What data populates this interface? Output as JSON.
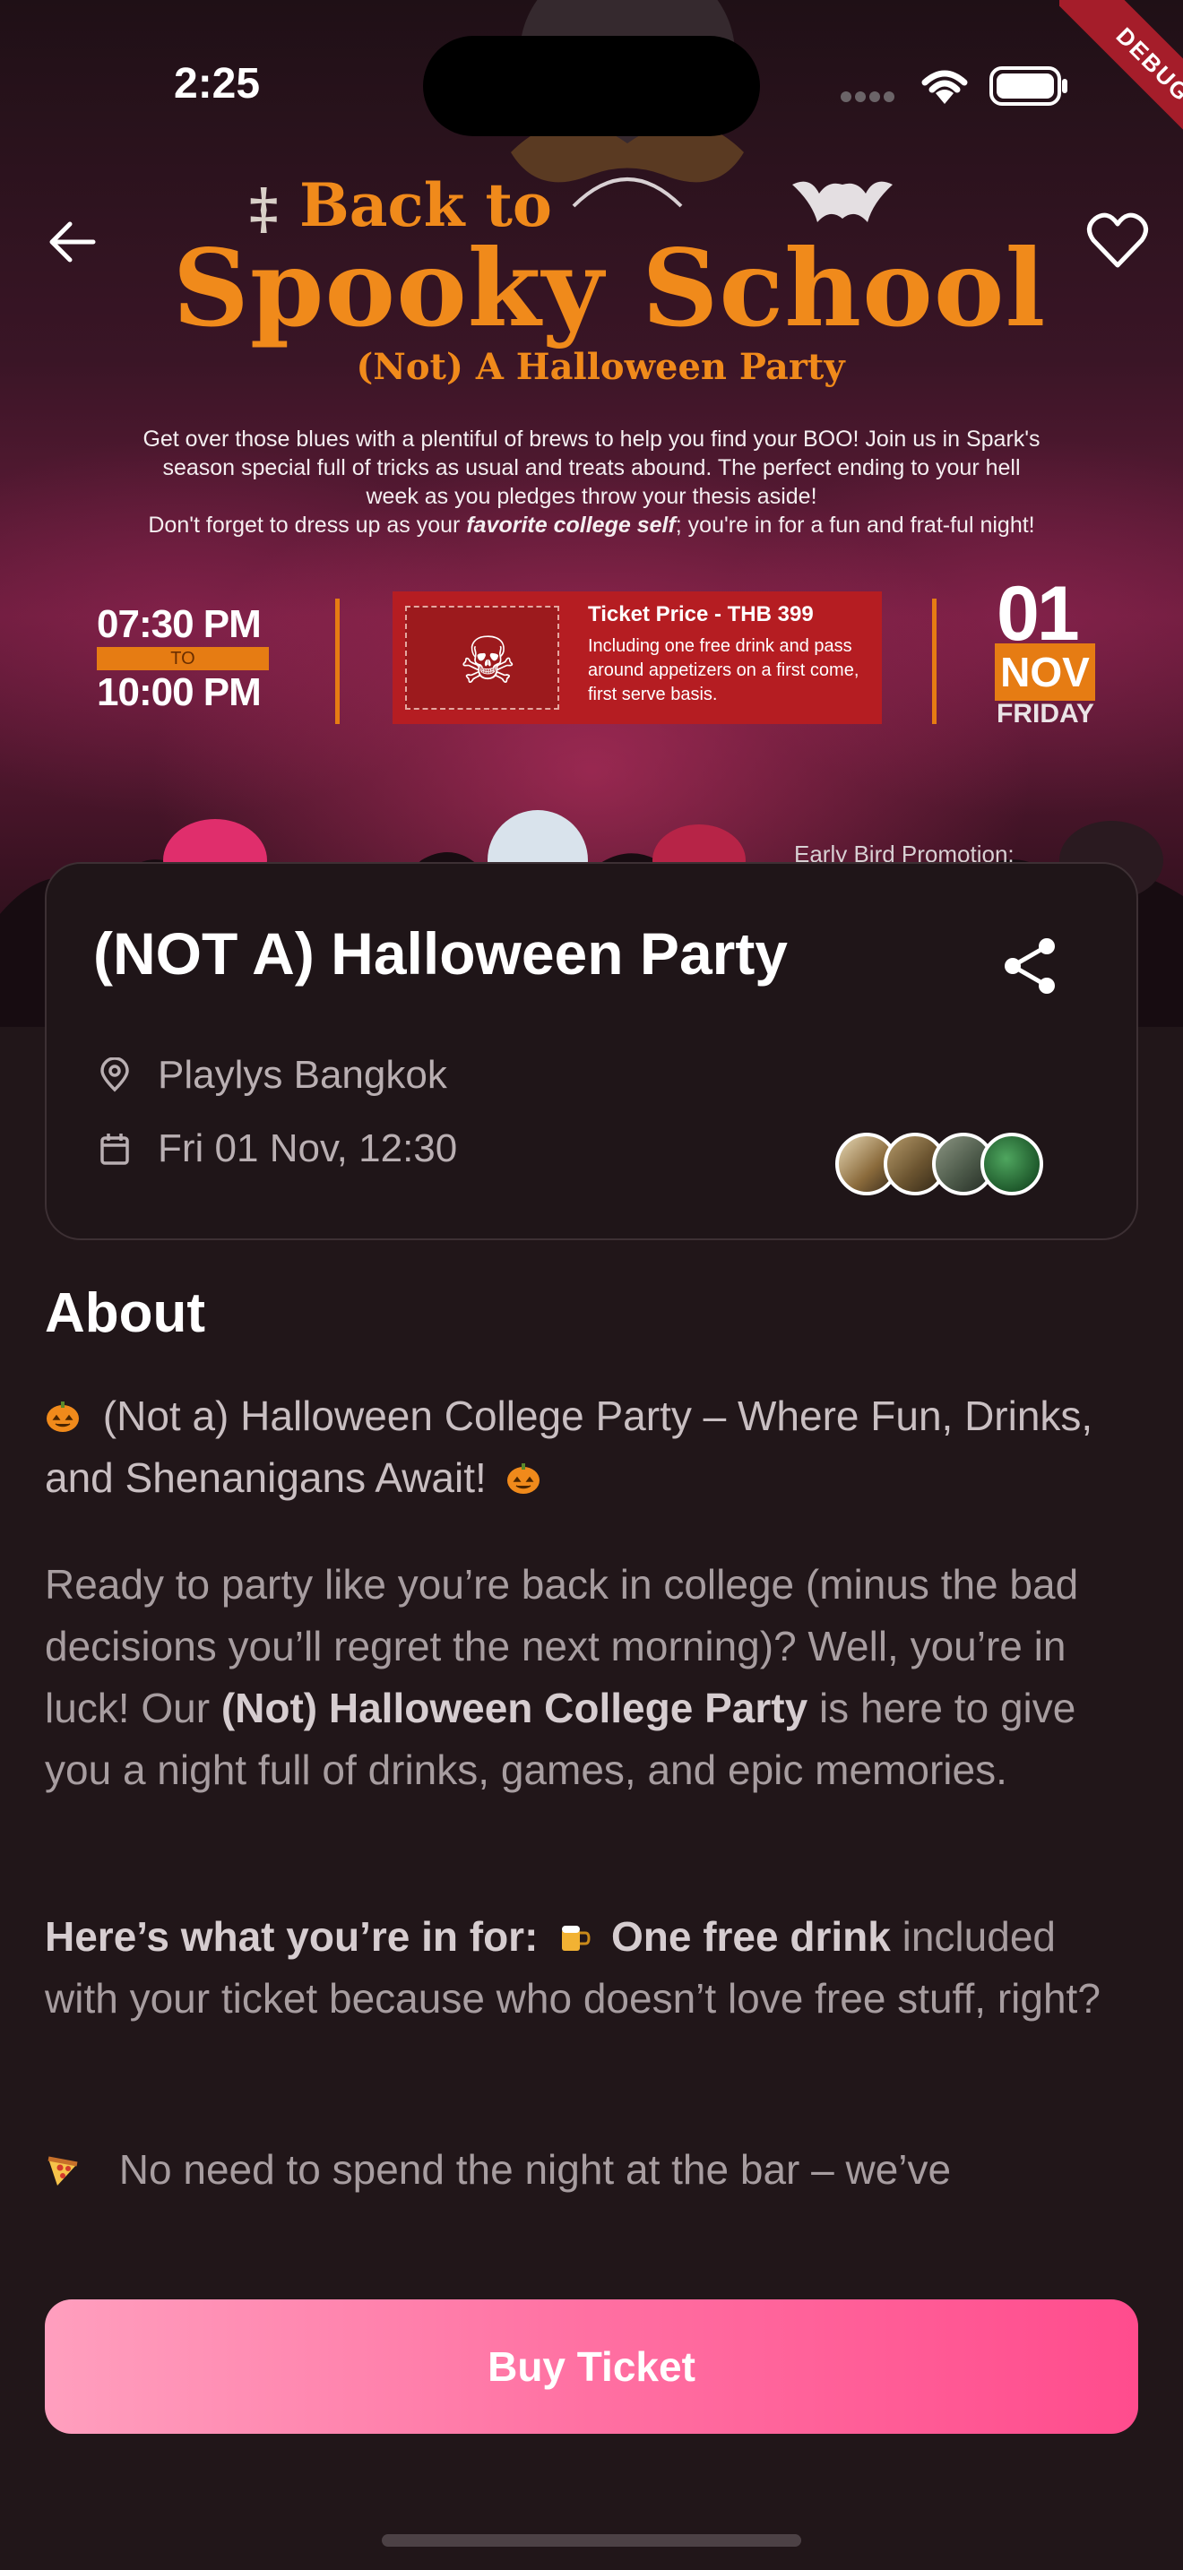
{
  "status_bar": {
    "time": "2:25",
    "debug_label": "DEBUG"
  },
  "poster": {
    "line1": "Back to",
    "line2": "Spooky School",
    "line3": "(Not) A Halloween Party",
    "description_lines": [
      "Get over those blues with a plentiful of brews to help you find your BOO! Join us in Spark's",
      "season special full of tricks as usual and treats abound. The perfect ending to your hell",
      "week as you pledges throw your thesis aside!"
    ],
    "description_last_pre": "Don't forget to dress up as your ",
    "description_last_bold": "favorite college self",
    "description_last_post": "; you're in for a fun and frat-ful night!",
    "time_start": "07:30 PM",
    "time_to": "TO",
    "time_end": "10:00 PM",
    "ticket_title": "Ticket Price - THB 399",
    "ticket_body": "Including one free drink and pass around appetizers on a first come, first serve basis.",
    "date_day_num": "01",
    "date_month": "NOV",
    "date_weekday": "FRIDAY",
    "promo_text": "Early Bird Promotion:"
  },
  "event": {
    "title": "(NOT A) Halloween Party",
    "location": "Playlys Bangkok",
    "datetime": "Fri 01 Nov, 12:30"
  },
  "about": {
    "heading": "About",
    "intro": "(Not a) Halloween College Party – Where Fun, Drinks, and Shenanigans Await!",
    "p1_pre": "Ready to party like you’re back in college (minus the bad decisions you’ll regret the next morning)? Well, you’re in luck! Our ",
    "p1_bold": "(Not) Halloween College Party",
    "p1_post": " is here to give you a night full of drinks, games, and epic memories.",
    "p2_bold1": "Here’s what you’re in for:",
    "p2_bold2": "One free drink",
    "p2_post": " included with your ticket because who doesn’t love free stuff, right?",
    "p3": "No need to spend the night at the bar – we’ve"
  },
  "buy_button": {
    "label": "Buy Ticket"
  },
  "colors": {
    "accent_pink": "#ff4c8d",
    "poster_orange": "#f08a1b",
    "background": "#211619"
  },
  "icons": [
    "back-arrow-icon",
    "heart-icon",
    "share-icon",
    "location-pin-icon",
    "calendar-icon",
    "pumpkin-icon",
    "beer-icon",
    "pizza-icon"
  ]
}
